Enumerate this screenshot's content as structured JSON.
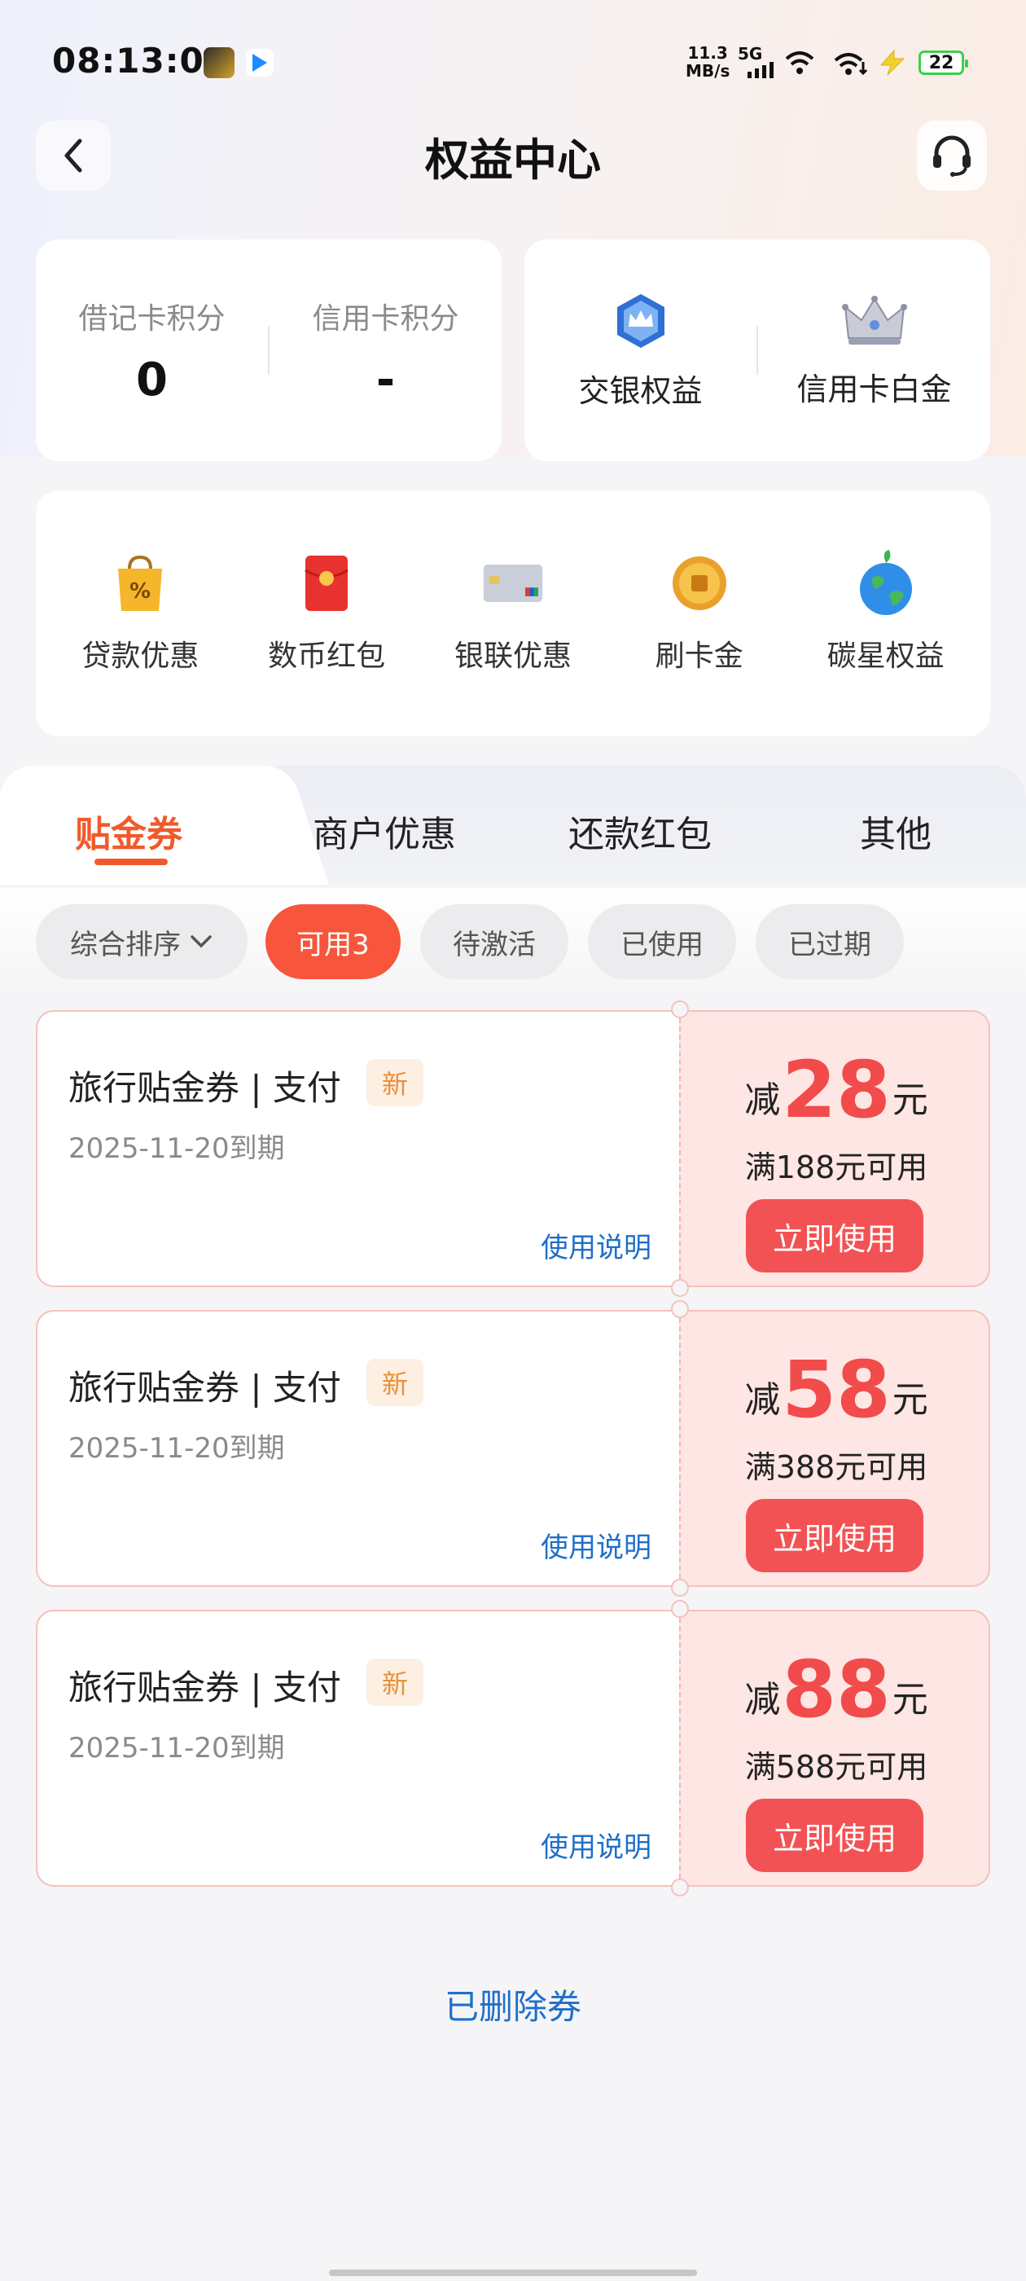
{
  "status_bar": {
    "time": "08:13:01",
    "net_speed_value": "11.3",
    "net_speed_unit": "MB/s",
    "signal_label": "5G",
    "battery": "22"
  },
  "header": {
    "title": "权益中心"
  },
  "points": {
    "debit_label": "借记卡积分",
    "debit_value": "0",
    "credit_label": "信用卡积分",
    "credit_value": "-"
  },
  "rights": {
    "bocom_label": "交银权益",
    "platinum_label": "信用卡白金"
  },
  "shortcuts": [
    {
      "label": "贷款优惠",
      "icon": "shopping-bag-icon"
    },
    {
      "label": "数币红包",
      "icon": "red-envelope-icon"
    },
    {
      "label": "银联优惠",
      "icon": "unionpay-card-icon"
    },
    {
      "label": "刷卡金",
      "icon": "gold-coin-icon"
    },
    {
      "label": "碳星权益",
      "icon": "earth-icon"
    }
  ],
  "tabs": [
    {
      "label": "贴金券",
      "active": true
    },
    {
      "label": "商户优惠"
    },
    {
      "label": "还款红包"
    },
    {
      "label": "其他"
    }
  ],
  "filters": {
    "sort_label": "综合排序",
    "chips": [
      "可用3",
      "待激活",
      "已使用",
      "已过期"
    ]
  },
  "coupons": [
    {
      "title": "旅行贴金券 | 支付",
      "badge": "新",
      "expiry": "2025-11-20到期",
      "help": "使用说明",
      "prefix": "减",
      "amount": "28",
      "unit": "元",
      "threshold": "满188元可用",
      "button": "立即使用"
    },
    {
      "title": "旅行贴金券 | 支付",
      "badge": "新",
      "expiry": "2025-11-20到期",
      "help": "使用说明",
      "prefix": "减",
      "amount": "58",
      "unit": "元",
      "threshold": "满388元可用",
      "button": "立即使用"
    },
    {
      "title": "旅行贴金券 | 支付",
      "badge": "新",
      "expiry": "2025-11-20到期",
      "help": "使用说明",
      "prefix": "减",
      "amount": "88",
      "unit": "元",
      "threshold": "满588元可用",
      "button": "立即使用"
    }
  ],
  "deleted_link": "已删除券",
  "colors": {
    "accent": "#f05a2a",
    "chip_active": "#f7553c",
    "coupon_red": "#f24b4b",
    "link_blue": "#1f6fc8"
  }
}
